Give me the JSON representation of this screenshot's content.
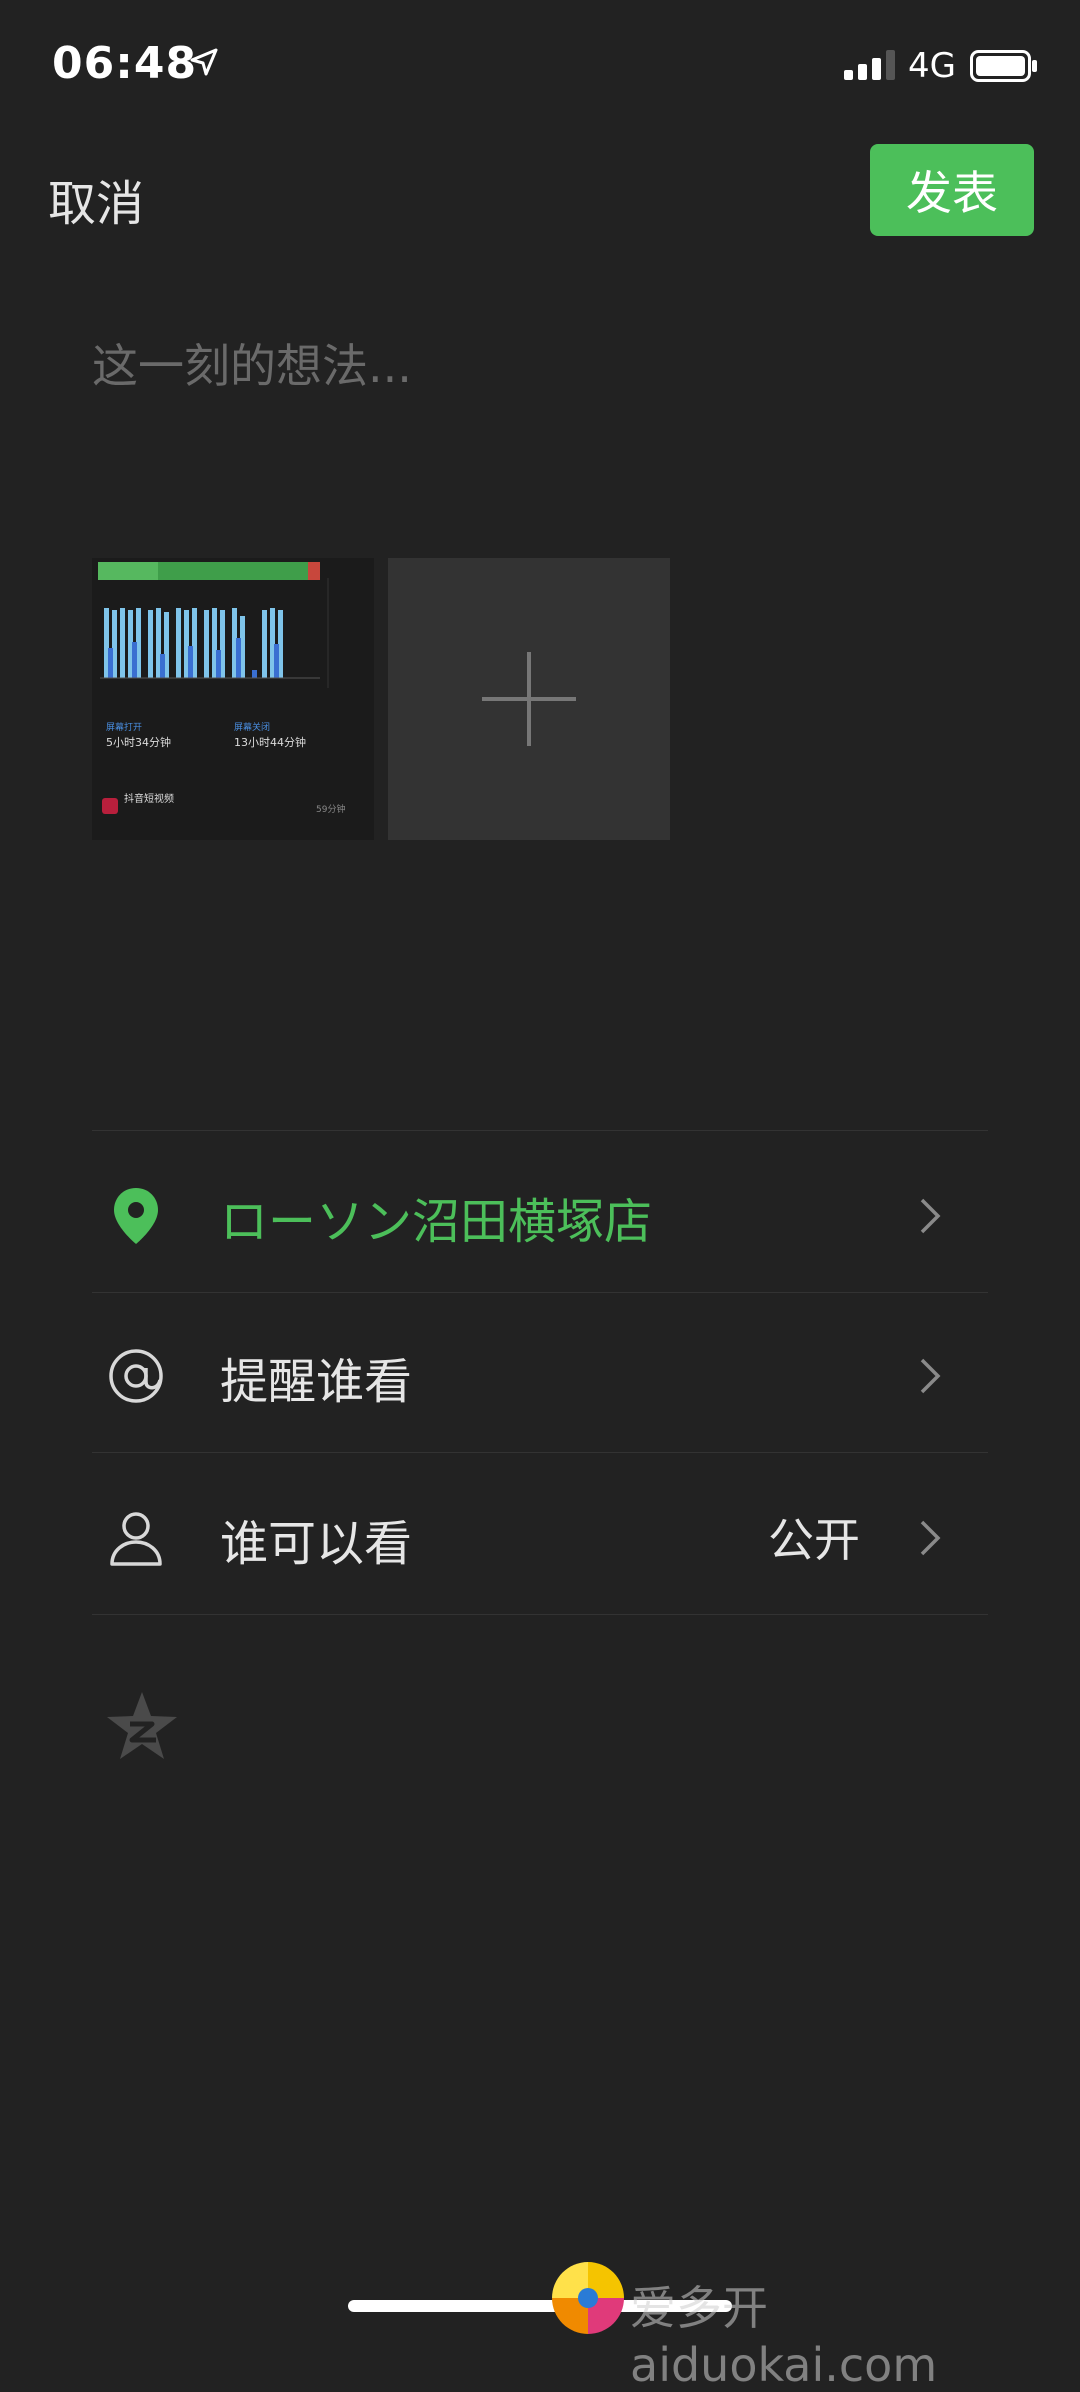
{
  "status_bar": {
    "time": "06:48",
    "network": "4G"
  },
  "header": {
    "cancel_label": "取消",
    "publish_label": "发表"
  },
  "composer": {
    "placeholder": "这一刻的想法..."
  },
  "thumbnail": {
    "stat_left_label": "屏幕打开",
    "stat_left_value": "5小时34分钟",
    "stat_right_label": "屏幕关闭",
    "stat_right_value": "13小时44分钟",
    "app_title": "抖音短视频",
    "app_duration": "59分钟"
  },
  "options": {
    "location_label": "ローソン沼田横塚店",
    "mention_label": "提醒谁看",
    "visibility_label": "谁可以看",
    "visibility_value": "公开"
  },
  "watermark": {
    "text": "爱多开aiduokai.com"
  },
  "colors": {
    "background": "#222222",
    "accent_green": "#4cbf5a"
  },
  "icons": [
    "location-pin-icon",
    "at-icon",
    "person-icon",
    "chevron-right-icon",
    "qzone-star-icon",
    "plus-icon"
  ]
}
